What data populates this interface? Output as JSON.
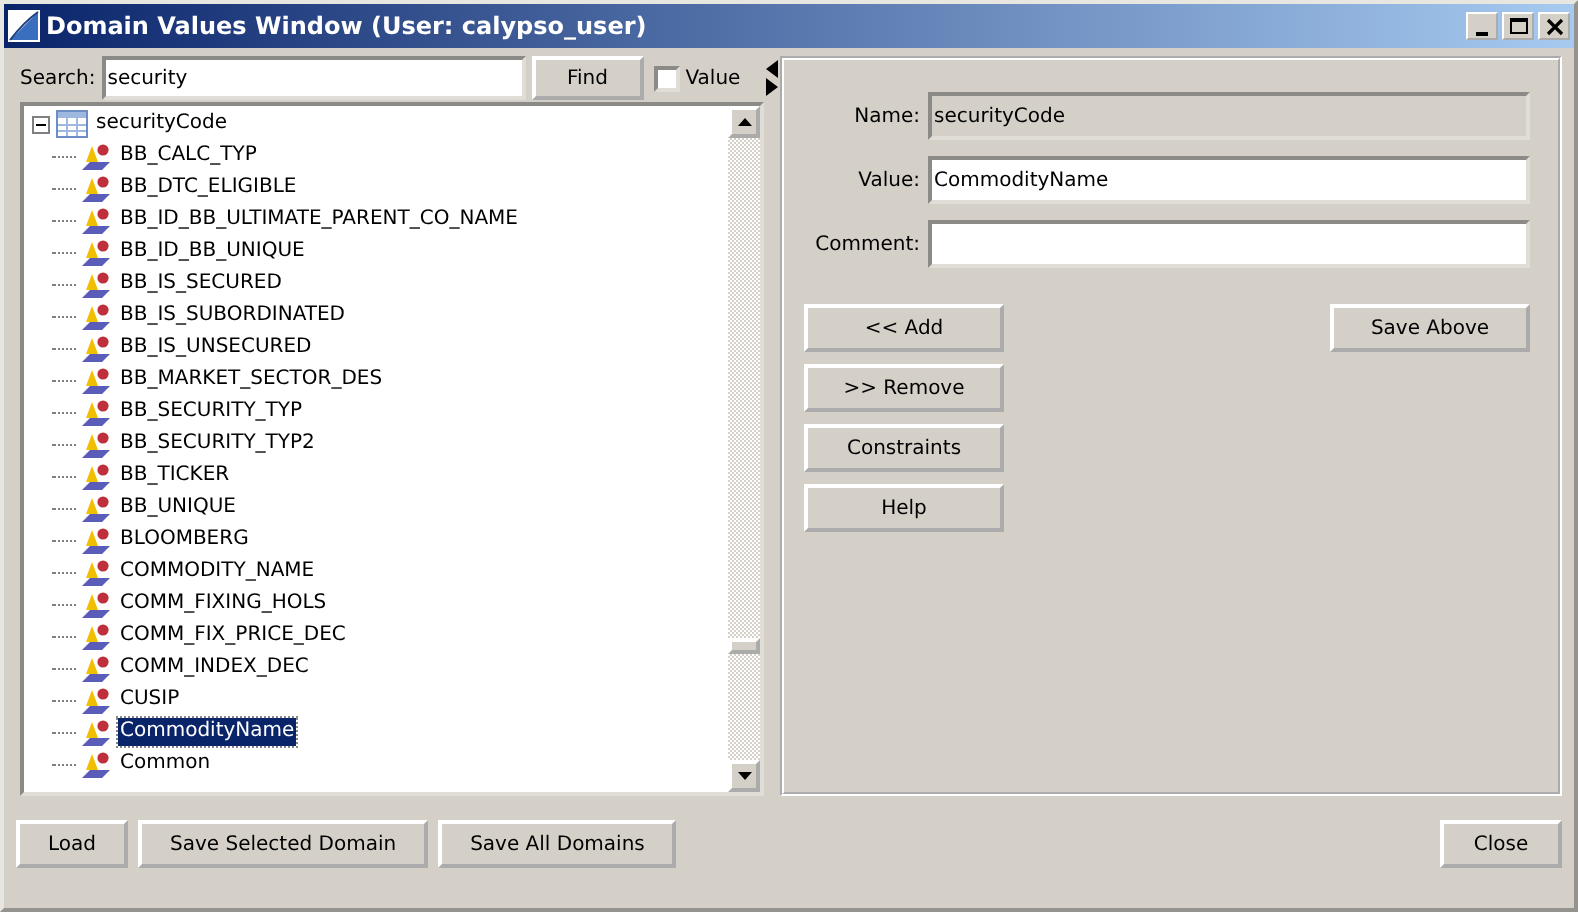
{
  "window": {
    "title": "Domain Values Window (User: calypso_user)"
  },
  "search": {
    "label": "Search:",
    "value": "security",
    "find_button": "Find",
    "value_checkbox": {
      "label": "Value",
      "checked": false
    }
  },
  "tree": {
    "root": {
      "label": "securityCode",
      "expanded": true,
      "children": [
        {
          "label": "BB_CALC_TYP",
          "selected": false
        },
        {
          "label": "BB_DTC_ELIGIBLE",
          "selected": false
        },
        {
          "label": "BB_ID_BB_ULTIMATE_PARENT_CO_NAME",
          "selected": false
        },
        {
          "label": "BB_ID_BB_UNIQUE",
          "selected": false
        },
        {
          "label": "BB_IS_SECURED",
          "selected": false
        },
        {
          "label": "BB_IS_SUBORDINATED",
          "selected": false
        },
        {
          "label": "BB_IS_UNSECURED",
          "selected": false
        },
        {
          "label": "BB_MARKET_SECTOR_DES",
          "selected": false
        },
        {
          "label": "BB_SECURITY_TYP",
          "selected": false
        },
        {
          "label": "BB_SECURITY_TYP2",
          "selected": false
        },
        {
          "label": "BB_TICKER",
          "selected": false
        },
        {
          "label": "BB_UNIQUE",
          "selected": false
        },
        {
          "label": "BLOOMBERG",
          "selected": false
        },
        {
          "label": "COMMODITY_NAME",
          "selected": false
        },
        {
          "label": "COMM_FIXING_HOLS",
          "selected": false
        },
        {
          "label": "COMM_FIX_PRICE_DEC",
          "selected": false
        },
        {
          "label": "COMM_INDEX_DEC",
          "selected": false
        },
        {
          "label": "CUSIP",
          "selected": false
        },
        {
          "label": "CommodityName",
          "selected": true
        },
        {
          "label": "Common",
          "selected": false
        }
      ]
    }
  },
  "form": {
    "fields": [
      {
        "label": "Name:",
        "value": "securityCode",
        "disabled": true
      },
      {
        "label": "Value:",
        "value": "CommodityName",
        "disabled": false
      },
      {
        "label": "Comment:",
        "disabled": false
      }
    ],
    "left_buttons": [
      "<< Add",
      ">> Remove",
      "Constraints",
      "Help"
    ],
    "save_button": "Save Above"
  },
  "footer": {
    "left_buttons": [
      "Load",
      "Save Selected Domain",
      "Save All Domains"
    ],
    "close_button": "Close"
  }
}
